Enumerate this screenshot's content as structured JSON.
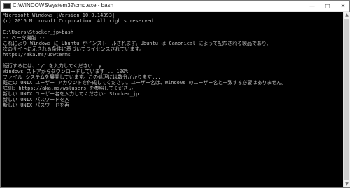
{
  "window": {
    "title": "C:\\WINDOWS\\system32\\cmd.exe - bash",
    "minimize_glyph": "—",
    "maximize_glyph": "□",
    "close_glyph": "✕"
  },
  "console": {
    "lines": [
      "Microsoft Windows [Version 10.0.14393]",
      "(c) 2016 Microsoft Corporation. All rights reserved.",
      "",
      "C:\\Users\\Stocker_jp>bash",
      "-- ベータ機能 --",
      "これにより Windows に Ubuntu がインストールされます。Ubuntu は Canonical によって配布される製品であり、",
      "次のサイトに示される条件に基づいてライセンスされています。",
      "https://aka.ms/uowterms",
      "",
      "続行するには、\"y\" を入力してください: y",
      "Windows ストアからダウンロードしています... 100%",
      "ファイル システムを展開しています。この処理には数分かかります...",
      "既定の UNIX ユーザー アカウントを作成してください。ユーザー名は、Windows のユーザー名と一致する必要はありません。",
      "詳細: https://aka.ms/wslusers を参照してください",
      "新しい UNIX ユーザー名を入力してください: Stocker_jp",
      "新しい UNIX パスワードを入",
      "新しい UNIX パスワードを再"
    ]
  },
  "scrollbar": {
    "up_glyph": "▲",
    "down_glyph": "▼"
  },
  "colors": {
    "console_bg": "#000000",
    "console_text": "#c0c0c0",
    "titlebar_bg": "#ffffff"
  }
}
